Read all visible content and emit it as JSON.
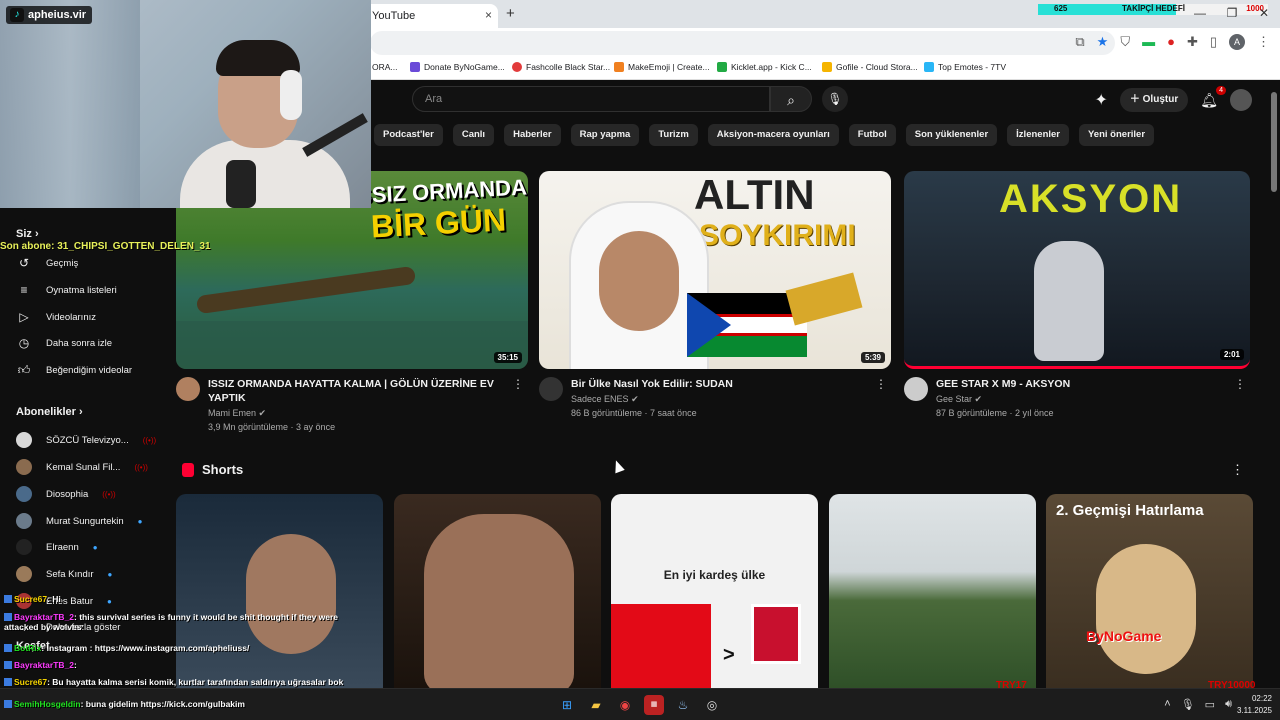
{
  "browser": {
    "tab_title": "YouTube",
    "tab_close": "×",
    "new_tab": "+",
    "window_controls": [
      "—",
      "❐",
      "✕"
    ],
    "goal": {
      "count": "625",
      "label": "TAKİPÇİ HEDEFİ",
      "target": "1000"
    },
    "bookmarks": [
      {
        "label": "ORA...",
        "color": "#888"
      },
      {
        "label": "Donate ByNoGame...",
        "color": "#6a4ad8"
      },
      {
        "label": "Fashcolle Black Star...",
        "color": "#e23b3b"
      },
      {
        "label": "MakeEmoji | Create...",
        "color": "#f08020"
      },
      {
        "label": "Kicklet.app - Kick C...",
        "color": "#22aa44"
      },
      {
        "label": "Gofile - Cloud Stora...",
        "color": "#f5b400"
      },
      {
        "label": "Top Emotes - 7TV",
        "color": "#29b6f6"
      }
    ],
    "profile_initial": "A"
  },
  "overlay": {
    "tiktok_handle": "apheius.vir",
    "sub_alert": "Son abone: 31_CHIPSI_GOTTEN_DELEN_31",
    "chat": [
      {
        "user": "Sucre67",
        "text": ": Hi"
      },
      {
        "user": "BayraktarTB_2",
        "text": ": this survival series is funny it would be shit thought if they were attacked by wolves"
      },
      {
        "user": "BotRix",
        "text": ": İnstagram : https://www.instagram.com/apheliuss/"
      },
      {
        "user": "BayraktarTB_2",
        "text": ":"
      },
      {
        "user": "Sucre67",
        "text": ": Bu hayatta kalma serisi komik, kurtlar tarafından saldırıya uğrasalar bok gibi düşünülürdü"
      },
      {
        "user": "SemihHosgeldin",
        "text": ": buna gidelim https://kick.com/gulbakim"
      }
    ],
    "try_left": "TRY17",
    "try_right": "TRY10000"
  },
  "youtube": {
    "search_placeholder": "Ara",
    "create_label": "Oluştur",
    "notif_count": "4",
    "chips": [
      "Podcast'ler",
      "Canlı",
      "Haberler",
      "Rap yapma",
      "Turizm",
      "Aksiyon-macera oyunları",
      "Futbol",
      "Son yüklenenler",
      "İzlenenler",
      "Yeni öneriler"
    ],
    "sidebar": {
      "you_label": "Siz",
      "you_items": [
        "Geçmiş",
        "Oynatma listeleri",
        "Videolarınız",
        "Daha sonra izle",
        "Beğendiğim videolar"
      ],
      "subs_label": "Abonelikler",
      "subs": [
        {
          "name": "SÖZCÜ Televizyo...",
          "status": "live"
        },
        {
          "name": "Kemal Sunal Fil...",
          "status": "live"
        },
        {
          "name": "Diosophia",
          "status": "live"
        },
        {
          "name": "Murat Sungurtekin",
          "status": "new"
        },
        {
          "name": "Elraenn",
          "status": "new"
        },
        {
          "name": "Sefa Kındır",
          "status": "new"
        },
        {
          "name": "Enes Batur",
          "status": "new"
        }
      ],
      "more_label": "Daha fazla göster",
      "explore_label": "Keşfet"
    },
    "videos": [
      {
        "title": "ISSIZ ORMANDA HAYATTA KALMA | GÖLÜN ÜZERİNE EV YAPTIK",
        "channel": "Mami Emen",
        "stats": "3,9 Mn görüntüleme · 3 ay önce",
        "duration": "35:15",
        "thumb_text_1": "ISSIZ ORMANDA",
        "thumb_text_2": "BİR GÜN"
      },
      {
        "title": "Bir Ülke Nasıl Yok Edilir: SUDAN",
        "channel": "Sadece ENES",
        "stats": "86 B görüntüleme · 7 saat önce",
        "duration": "5:39",
        "thumb_text_1": "ALTIN",
        "thumb_text_2": "SOYKIRIMI"
      },
      {
        "title": "GEE STAR X M9 - AKSYON",
        "channel": "Gee Star",
        "stats": "87 B görüntüleme · 2 yıl önce",
        "duration": "2:01",
        "thumb_text_1": "AKSYON",
        "thumb_text_2": ""
      }
    ],
    "shorts_label": "Shorts",
    "shorts": [
      {
        "caption": ""
      },
      {
        "caption": ""
      },
      {
        "caption": "En iyi kardeş ülke"
      },
      {
        "caption": ""
      },
      {
        "caption": "2. Geçmişi Hatırlama"
      }
    ],
    "shorts_watermark": "ByNoGame"
  },
  "taskbar": {
    "time": "02:22",
    "date": "3.11.2025"
  }
}
